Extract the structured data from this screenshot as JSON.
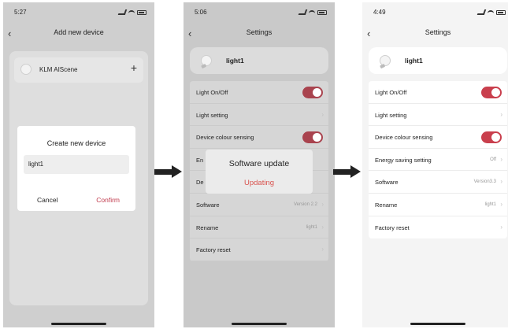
{
  "phone1": {
    "time": "5:27",
    "title": "Add new device",
    "device_name": "KLM AIScene",
    "dialog": {
      "title": "Create new device",
      "input_value": "light1",
      "cancel": "Cancel",
      "confirm": "Confirm"
    }
  },
  "phone2": {
    "time": "5:06",
    "title": "Settings",
    "device_name": "light1",
    "rows": {
      "light_onoff": "Light On/Off",
      "light_setting": "Light setting",
      "colour_sensing": "Device colour sensing",
      "energy_partial": "En",
      "default_partial": "De",
      "software": "Software",
      "software_value": "Version 2.2",
      "rename": "Rename",
      "rename_value": "light1",
      "factory_reset": "Factory reset"
    },
    "dialog": {
      "title": "Software update",
      "status": "Updating"
    }
  },
  "phone3": {
    "time": "4:49",
    "title": "Settings",
    "device_name": "light1",
    "rows": {
      "light_onoff": "Light On/Off",
      "light_setting": "Light setting",
      "colour_sensing": "Device colour sensing",
      "energy_saving": "Energy saving setting",
      "energy_value": "Off",
      "software": "Software",
      "software_value": "Version3.3",
      "rename": "Rename",
      "rename_value": "light1",
      "factory_reset": "Factory reset"
    }
  },
  "icons": {
    "back": "chevron-left-icon",
    "chevron": "chevron-right-icon",
    "plus": "plus-icon",
    "bulb": "bulb-icon",
    "arrow": "arrow-right-icon"
  },
  "colors": {
    "accent": "#c93f4d",
    "updating": "#d9534f"
  },
  "toggles": {
    "light_onoff": true,
    "colour_sensing": true
  }
}
